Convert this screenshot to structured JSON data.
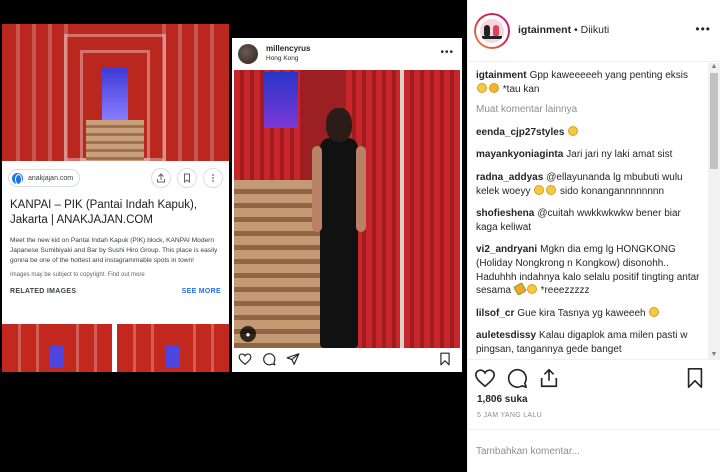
{
  "colors": {
    "accent": "#1a73e8",
    "ig_text": "#262626",
    "muted": "#8e8e8e",
    "red": "#c2281e"
  },
  "google_card": {
    "source": "anakjajan.com",
    "title": "KANPAI – PIK (Pantai Indah Kapuk), Jakarta | ANAKJAJAN.COM",
    "description": "Meet the new kid on Pantai Indah Kapuk (PIK) block, KANPAI Modern Japanese Sumibiyaki and Bar by Sushi Hiro Group. This place is easily gonna be one of the hottest and instagrammable spots in town!",
    "copyright": "Images may be subject to copyright. Find out more",
    "related_title": "RELATED IMAGES",
    "see_more": "SEE MORE",
    "icons": [
      "share-icon",
      "bookmark-icon",
      "more-vert-icon"
    ]
  },
  "embedded_post": {
    "username": "millencyrus",
    "location": "Hong Kong",
    "icons": [
      "heart-icon",
      "comment-icon",
      "share-icon",
      "save-icon"
    ]
  },
  "panel": {
    "username": "igtainment",
    "follow_status": "Diikuti",
    "separator": " • ",
    "load_more": "Muat komentar lainnya",
    "comments": [
      {
        "user": "igtainment",
        "text": "Gpp kaweeeeeh yang penting eksis",
        "emojis": [
          "laugh",
          "sad"
        ],
        "tail": " *tau kan"
      },
      {
        "user": "eenda_cjp27styles",
        "text": "",
        "emojis": [
          "smile"
        ],
        "tail": ""
      },
      {
        "user": "mayankyoniaginta",
        "text": "Jari jari ny laki amat sist",
        "emojis": [],
        "tail": ""
      },
      {
        "user": "radna_addyas",
        "text": "@ellayunanda lg mbubuti wulu kelek woeyy",
        "emojis": [
          "laugh",
          "laugh"
        ],
        "tail": " sido konangannnnnnnn"
      },
      {
        "user": "shofieshena",
        "text": "@cuitah wwkkwkwkw bener biar kaga keliwat",
        "emojis": [],
        "tail": ""
      },
      {
        "user": "vi2_andryani",
        "text": "Mgkn dia emg lg HONGKONG (Holiday Nongkrong n Kongkow) disonohh.. Haduhhh indahnya kalo selalu positif tingting antar sesama",
        "emojis": [
          "corn",
          "laugh"
        ],
        "tail": " *reeezzzzz"
      },
      {
        "user": "lilsof_cr",
        "text": "Gue kira Tasnya yg kaweeeh",
        "emojis": [
          "smile"
        ],
        "tail": ""
      },
      {
        "user": "auletesdissy",
        "text": "Kalau digaplok ama milen pasti w pingsan, tangannya gede banget",
        "emojis": [],
        "tail": ""
      }
    ],
    "likes": "1,806 suka",
    "time": "5 JAM YANG LALU",
    "comment_placeholder": "Tambahkan komentar..."
  }
}
